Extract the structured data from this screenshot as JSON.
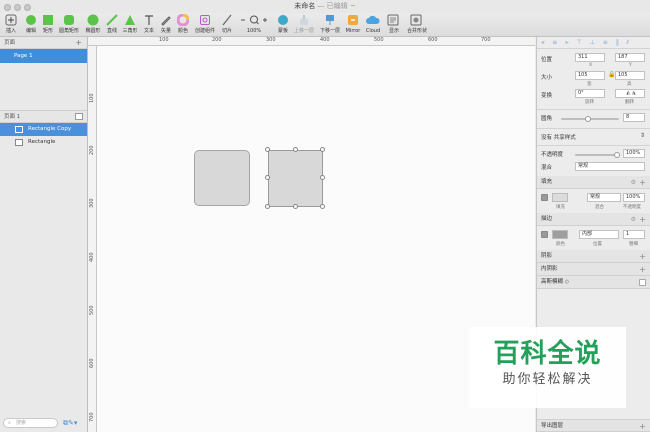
{
  "window": {
    "title": "未命名",
    "subtitle": "— 已编辑 ~"
  },
  "toolbar": {
    "insert": "插入",
    "edit": "编辑",
    "vector": "矩形",
    "rounded_rect": "圆角矩形",
    "oval": "椭圆形",
    "line": "直线",
    "triangle": "三角形",
    "text": "文本",
    "pen": "矢量",
    "color": "颜色",
    "create_symbol": "创建组件",
    "slice": "切片",
    "zoom": "100%",
    "artboard": "蒙板",
    "forward": "上移一层",
    "backward": "下移一层",
    "mirror": "Mirror",
    "cloud": "Cloud",
    "view": "显示",
    "combine": "合并形状"
  },
  "ruler_top": [
    "100",
    "200",
    "300",
    "400",
    "500",
    "600",
    "700"
  ],
  "ruler_left": [
    "100",
    "200",
    "300",
    "400",
    "500",
    "600",
    "700"
  ],
  "sidebar": {
    "pages_header": "页面",
    "pages": [
      "Page 1"
    ],
    "layers_header": "页面 1",
    "layers": [
      "Rectangle Copy",
      "Rectangle"
    ],
    "search_placeholder": "搜索"
  },
  "inspector": {
    "position_label": "位置",
    "x_value": "311",
    "y_value": "187",
    "x_sub": "X",
    "y_sub": "Y",
    "size_label": "大小",
    "w_value": "105",
    "h_value": "105",
    "w_sub": "宽",
    "h_sub": "高",
    "transform_label": "变换",
    "rotate_value": "0°",
    "rotate_sub": "旋转",
    "flip_sub": "翻转",
    "radius_label": "圆角",
    "radius_value": "8",
    "shared_style": "没有 共享样式",
    "opacity_label": "不透明度",
    "opacity_value": "100%",
    "blend_label": "混合",
    "blend_value": "常规",
    "fill_label": "填充",
    "fill_mode": "常规",
    "fill_opacity": "100%",
    "fill_sub1": "填充",
    "fill_sub2": "混合",
    "fill_sub3": "不透明度",
    "border_label": "描边",
    "border_pos": "内部",
    "border_width": "1",
    "border_sub1": "颜色",
    "border_sub2": "位置",
    "border_sub3": "粗细",
    "shadow_label": "阴影",
    "inner_shadow_label": "内阴影",
    "blur_label": "高斯模糊 ◇",
    "export_label": "导出图层"
  },
  "watermark": {
    "big": "百科全说",
    "small": "助你轻松解决"
  },
  "colors": {
    "accent": "#3f8edb",
    "watermark_green": "#23a05a",
    "shape_fill": "#d8d8d8"
  }
}
